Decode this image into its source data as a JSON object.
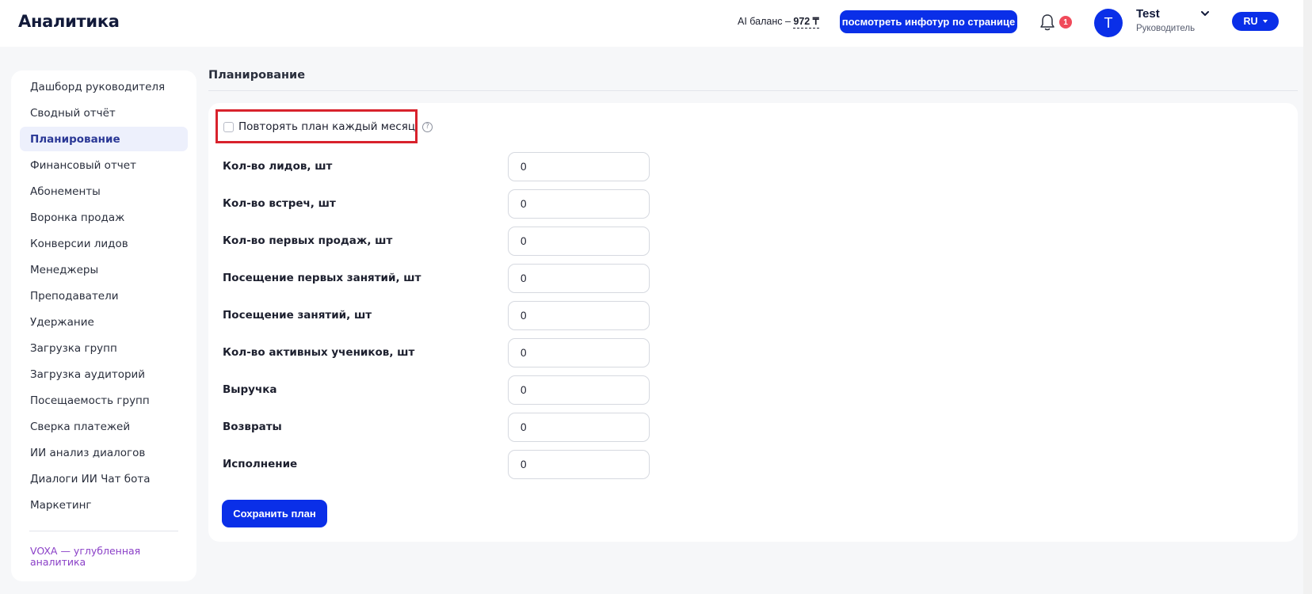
{
  "header": {
    "app_title": "Аналитика",
    "ai_balance_label": "AI баланс – ",
    "ai_balance_amount": "972 ₸",
    "info_tour_button": "посмотреть инфотур по странице",
    "notification_count": "1",
    "user": {
      "avatar_letter": "T",
      "name": "Test",
      "role": "Руководитель"
    },
    "language": "RU"
  },
  "sidebar": {
    "items": [
      {
        "label": "Дашборд руководителя",
        "active": false
      },
      {
        "label": "Сводный отчёт",
        "active": false
      },
      {
        "label": "Планирование",
        "active": true
      },
      {
        "label": "Финансовый отчет",
        "active": false
      },
      {
        "label": "Абонементы",
        "active": false
      },
      {
        "label": "Воронка продаж",
        "active": false
      },
      {
        "label": "Конверсии лидов",
        "active": false
      },
      {
        "label": "Менеджеры",
        "active": false
      },
      {
        "label": "Преподаватели",
        "active": false
      },
      {
        "label": "Удержание",
        "active": false
      },
      {
        "label": "Загрузка групп",
        "active": false
      },
      {
        "label": "Загрузка аудиторий",
        "active": false
      },
      {
        "label": "Посещаемость групп",
        "active": false
      },
      {
        "label": "Сверка платежей",
        "active": false
      },
      {
        "label": "ИИ анализ диалогов",
        "active": false
      },
      {
        "label": "Диалоги ИИ Чат бота",
        "active": false
      },
      {
        "label": "Маркетинг",
        "active": false
      }
    ],
    "extra_link": "VOXA — углубленная аналитика"
  },
  "main": {
    "page_title": "Планирование",
    "repeat_plan_label": "Повторять план каждый месяц",
    "repeat_plan_checked": false,
    "help_glyph": "?",
    "fields": [
      {
        "label": "Кол-во лидов, шт",
        "value": "0"
      },
      {
        "label": "Кол-во встреч, шт",
        "value": "0"
      },
      {
        "label": "Кол-во первых продаж, шт",
        "value": "0"
      },
      {
        "label": "Посещение первых занятий, шт",
        "value": "0"
      },
      {
        "label": "Посещение занятий, шт",
        "value": "0"
      },
      {
        "label": "Кол-во активных учеников, шт",
        "value": "0"
      },
      {
        "label": "Выручка",
        "value": "0"
      },
      {
        "label": "Возвраты",
        "value": "0"
      },
      {
        "label": "Исполнение",
        "value": "0"
      }
    ],
    "save_button": "Сохранить план"
  },
  "colors": {
    "accent": "#0a2fe8",
    "badge": "#f04a5a",
    "highlight": "#d8222c",
    "link": "#8a3fc7",
    "active_item_bg": "#edf0fc"
  },
  "icons": {
    "bell": "bell-icon",
    "chevron": "chevron-down-icon",
    "help": "help-circle-icon"
  }
}
